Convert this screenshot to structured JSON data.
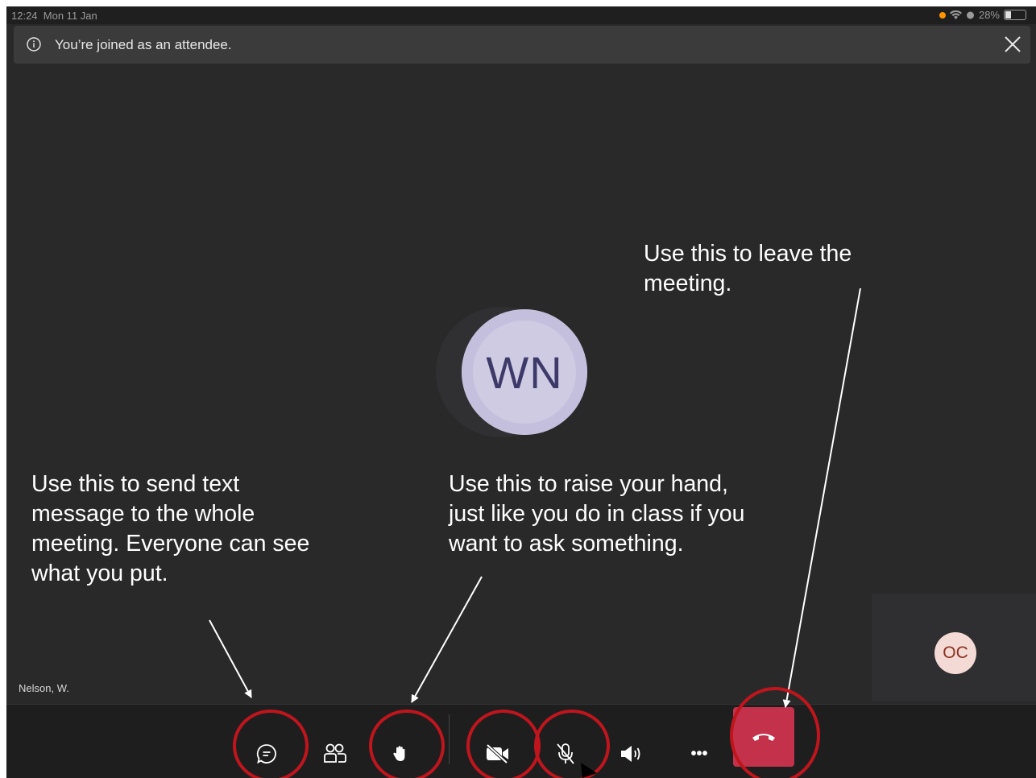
{
  "status_bar": {
    "time": "12:24",
    "date": "Mon 11 Jan",
    "battery": "28%"
  },
  "banner": {
    "message": "You’re joined as an attendee."
  },
  "stage": {
    "avatar_initials": "WN",
    "participant_name": "Nelson, W.",
    "self_initials": "OC"
  },
  "toolbar": {
    "buttons": [
      "chat-icon",
      "people-icon",
      "raise-hand-icon",
      "camera-off-icon",
      "mic-off-icon",
      "speaker-icon",
      "more-icon",
      "hang-up-icon"
    ],
    "more_label": "•••"
  },
  "annotations": {
    "leave": "Use this to leave the\nmeeting.",
    "chat": "Use this to send text\nmessage to the whole\nmeeting. Everyone can see\nwhat you put.",
    "hand": "Use this to raise your hand,\njust like you do in class if you\nwant to ask something."
  },
  "colors": {
    "background": "#2a292a",
    "toolbar": "#1e1e1f",
    "leave_button": "#c4314b",
    "highlight_circle": "#c0151c",
    "avatar": "#cfcbe3"
  }
}
